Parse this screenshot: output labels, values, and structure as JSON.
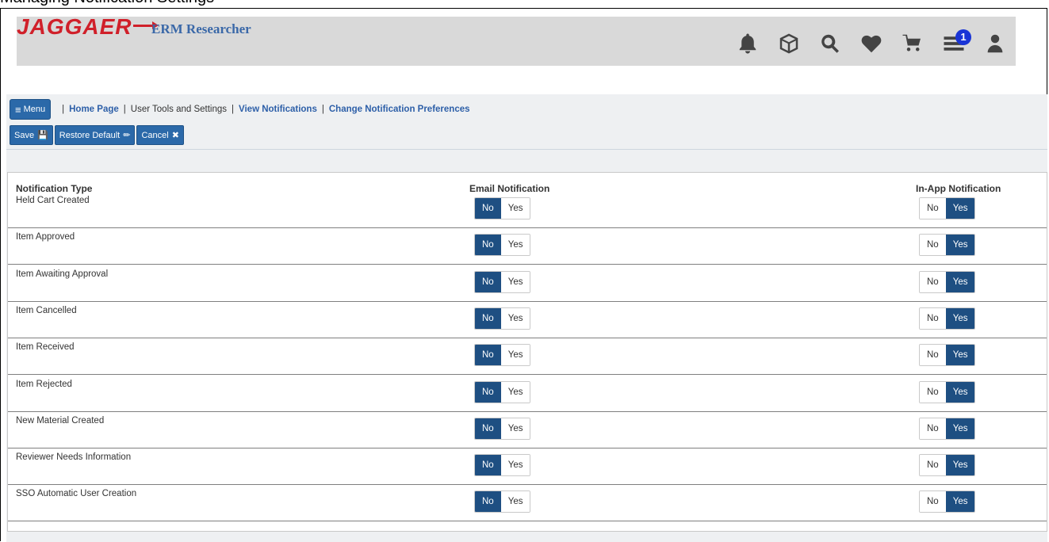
{
  "cropped_top_text": "Managing Notification Settings",
  "header": {
    "logo_text": "JAGGAER",
    "app_title": "ERM Researcher",
    "icons": [
      "bell-icon",
      "box-icon",
      "search-icon",
      "heart-icon",
      "cart-icon",
      "list-icon",
      "user-icon"
    ],
    "badge_count": "1"
  },
  "breadcrumb": {
    "menu_label": "Menu",
    "home": "Home Page",
    "tools": "User Tools and Settings",
    "view": "View Notifications",
    "change": "Change Notification Preferences"
  },
  "actions": {
    "save": "Save",
    "restore": "Restore Default",
    "cancel": "Cancel"
  },
  "table": {
    "col_type": "Notification Type",
    "col_email": "Email Notification",
    "col_inapp": "In-App Notification",
    "rows": [
      {
        "label": "Held Cart Created",
        "email": "No",
        "inapp": "Yes"
      },
      {
        "label": "Item Approved",
        "email": "No",
        "inapp": "Yes"
      },
      {
        "label": "Item Awaiting Approval",
        "email": "No",
        "inapp": "Yes"
      },
      {
        "label": "Item Cancelled",
        "email": "No",
        "inapp": "Yes"
      },
      {
        "label": "Item Received",
        "email": "No",
        "inapp": "Yes"
      },
      {
        "label": "Item Rejected",
        "email": "No",
        "inapp": "Yes"
      },
      {
        "label": "New Material Created",
        "email": "No",
        "inapp": "Yes"
      },
      {
        "label": "Reviewer Needs Information",
        "email": "No",
        "inapp": "Yes"
      },
      {
        "label": "SSO Automatic User Creation",
        "email": "No",
        "inapp": "Yes"
      }
    ],
    "no_label": "No",
    "yes_label": "Yes"
  },
  "colors": {
    "accent": "#2b69a9",
    "toggle_on": "#1e4f82",
    "logo_red": "#d0202a",
    "title_blue": "#3a68a8"
  }
}
